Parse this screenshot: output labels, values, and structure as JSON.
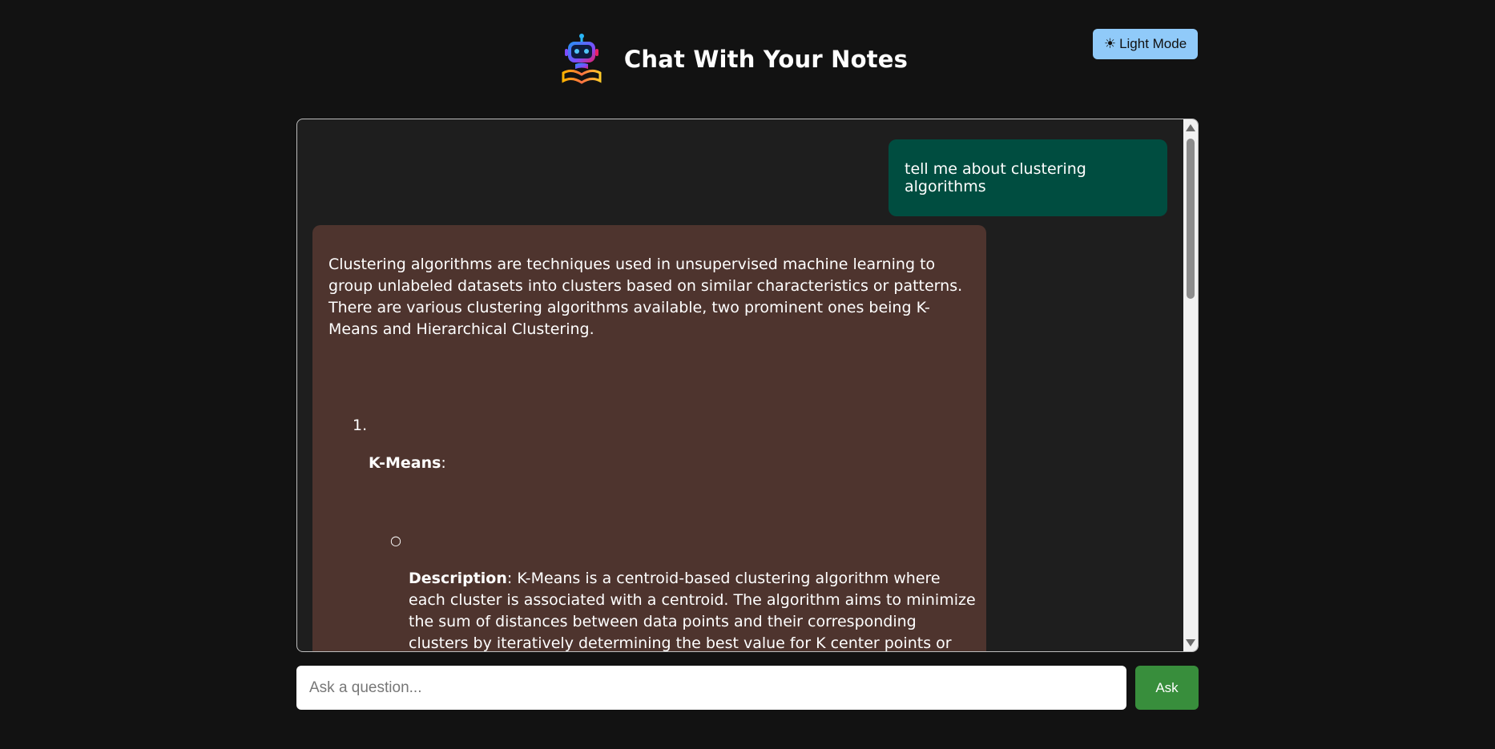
{
  "header": {
    "logo_icon": "robot-book-icon",
    "title": "Chat With Your Notes"
  },
  "theme_toggle": {
    "icon": "☀",
    "label": "Light Mode",
    "color": "#90caf9"
  },
  "chat": {
    "user_message": {
      "text": "tell me about clustering algorithms",
      "color": "#004d40"
    },
    "bot_message": {
      "color": "#4e342e",
      "intro": "Clustering algorithms are techniques used in unsupervised machine learning to group unlabeled datasets into clusters based on similar characteristics or patterns. There are various clustering algorithms available, two prominent ones being K-Means and Hierarchical Clustering.",
      "list": [
        {
          "number": "1.",
          "title": "K-Means",
          "title_suffix": ":",
          "bullets": [
            {
              "marker": "○",
              "label": "Description",
              "text": ": K-Means is a centroid-based clustering algorithm where each cluster is associated with a centroid. The algorithm aims to minimize the sum of distances between data points and their corresponding clusters by iteratively determining the best value for K center points or centroids."
            }
          ]
        }
      ]
    }
  },
  "input": {
    "placeholder": "Ask a question...",
    "value": ""
  },
  "ask_button": {
    "label": "Ask",
    "color": "#388e3c"
  }
}
